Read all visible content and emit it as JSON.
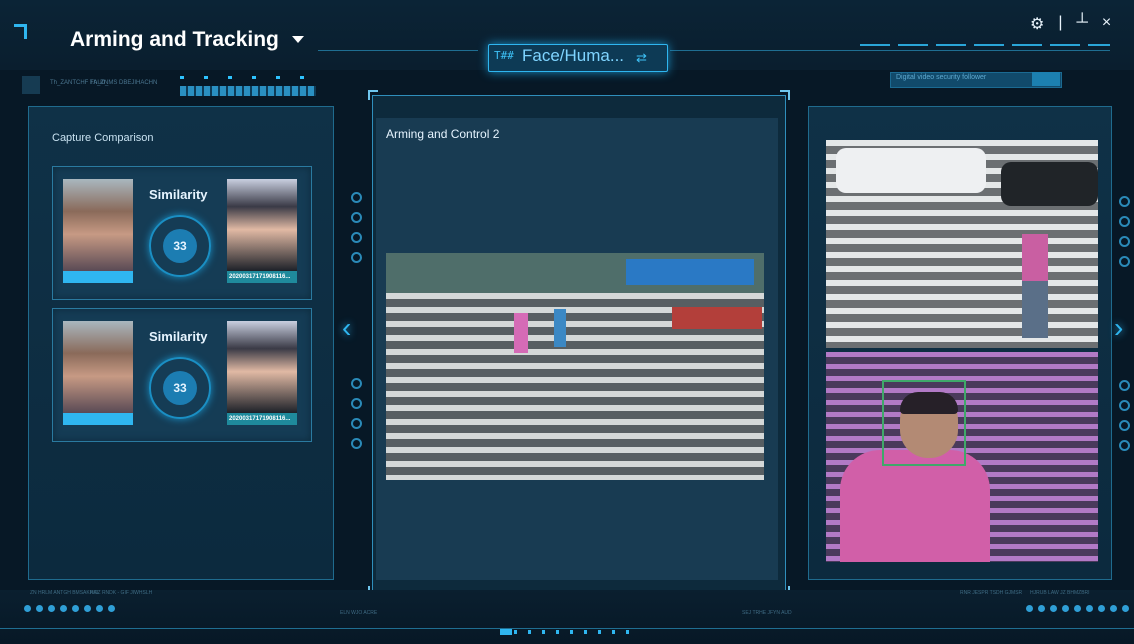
{
  "header": {
    "title": "Arming and Tracking",
    "mode_prefix": "T##",
    "mode_label": "Face/Huma...",
    "mode_swap_icon": "⇄",
    "settings_icon": "⚙",
    "separator": "|",
    "minimize_icon": "┴",
    "close_icon": "×"
  },
  "strip": {
    "text1": "Th_ZANTCHF  FAU0_",
    "text2": "Th_ZNMS  DBEJIHACHN",
    "search_placeholder": "Digital video security follower"
  },
  "left_panel": {
    "title": "Capture Comparison",
    "comparisons": [
      {
        "similarity_label": "Similarity",
        "score": "33",
        "photo_id": "20200317171908116..."
      },
      {
        "similarity_label": "Similarity",
        "score": "33",
        "photo_id": "20200317171908116..."
      }
    ]
  },
  "center_panel": {
    "title": "Arming and Control 2"
  },
  "nav": {
    "prev_icon": "‹",
    "next_icon": "›"
  },
  "footer": {
    "m1": "ZN HRLM ANTGH  BMSAKRAL",
    "m2": "HOZ  RNDK  - GIF  JIWHSLH",
    "m3": "ELN  WJO  ACRE",
    "m4": "SEJ  TRHE  JFYN  AUD",
    "m5": "RNR  JESPR  TSDH  GJMSR",
    "m6": "HJRUB  LAW  JZ  BHMZBRI"
  },
  "colors": {
    "accent": "#2fb6f0",
    "panel": "#0f3147",
    "background": "#071826"
  }
}
